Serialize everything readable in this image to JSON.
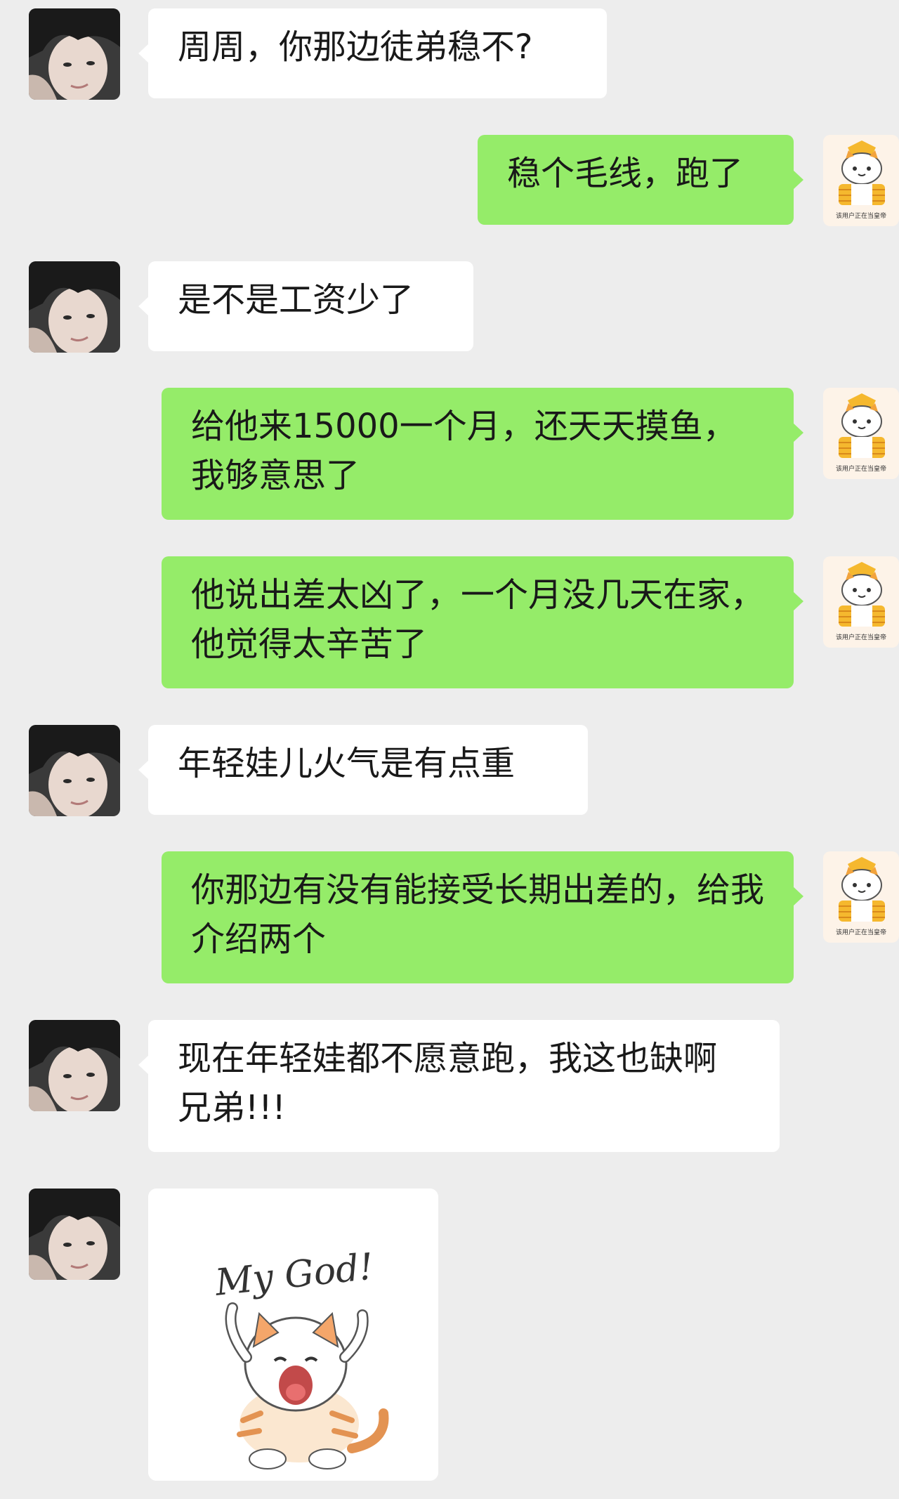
{
  "colors": {
    "background": "#ededed",
    "incoming_bubble": "#ffffff",
    "outgoing_bubble": "#95ec69",
    "text": "#191919"
  },
  "messages": [
    {
      "from": "friend",
      "text": "周周，你那边徒弟稳不?"
    },
    {
      "from": "me",
      "text": "稳个毛线，跑了"
    },
    {
      "from": "friend",
      "text": "是不是工资少了"
    },
    {
      "from": "me",
      "text": "给他来15000一个月，还天天摸鱼，我够意思了"
    },
    {
      "from": "me",
      "text": "他说出差太凶了，一个月没几天在家，他觉得太辛苦了"
    },
    {
      "from": "friend",
      "text": "年轻娃儿火气是有点重"
    },
    {
      "from": "me",
      "text": "你那边有没有能接受长期出差的，给我介绍两个"
    },
    {
      "from": "friend",
      "text": "现在年轻娃都不愿意跑，我这也缺啊兄弟!!!"
    },
    {
      "from": "friend",
      "type": "sticker",
      "sticker": {
        "text": "My God!",
        "icon": "crying-cat-sticker"
      }
    }
  ],
  "my_avatar": {
    "icon": "cat-emperor-avatar",
    "caption": "该用户正在当皇帝"
  },
  "friend_avatar": {
    "icon": "person-portrait-avatar"
  }
}
